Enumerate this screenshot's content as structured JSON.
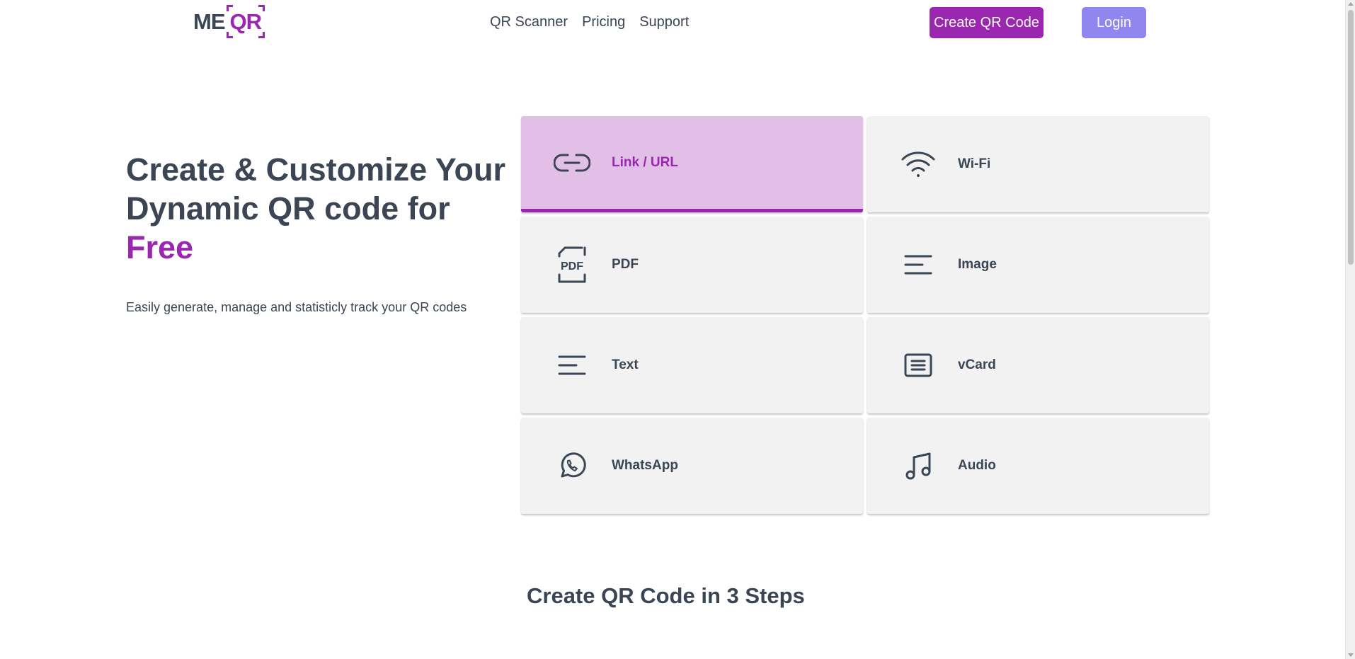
{
  "brand": {
    "logo_left": "ME",
    "logo_right": "QR",
    "accent_color": "#9b27b0"
  },
  "nav": {
    "items": [
      {
        "label": "QR Scanner"
      },
      {
        "label": "Pricing"
      },
      {
        "label": "Support"
      }
    ]
  },
  "header": {
    "create_label": "Create QR Code",
    "login_label": "Login"
  },
  "hero": {
    "title_part1": "Create & Customize Your Dynamic QR code for ",
    "title_accent": "Free",
    "subtitle": "Easily generate, manage and statisticly track your QR codes"
  },
  "types": [
    {
      "label": "Link / URL",
      "icon": "link-icon",
      "active": true
    },
    {
      "label": "Wi-Fi",
      "icon": "wifi-icon",
      "active": false
    },
    {
      "label": "PDF",
      "icon": "pdf-icon",
      "active": false
    },
    {
      "label": "Image",
      "icon": "lines-icon",
      "active": false
    },
    {
      "label": "Text",
      "icon": "lines-icon",
      "active": false
    },
    {
      "label": "vCard",
      "icon": "vcard-icon",
      "active": false
    },
    {
      "label": "WhatsApp",
      "icon": "whatsapp-icon",
      "active": false
    },
    {
      "label": "Audio",
      "icon": "music-note-icon",
      "active": false
    }
  ],
  "steps": {
    "title": "Create QR Code in 3 Steps"
  }
}
